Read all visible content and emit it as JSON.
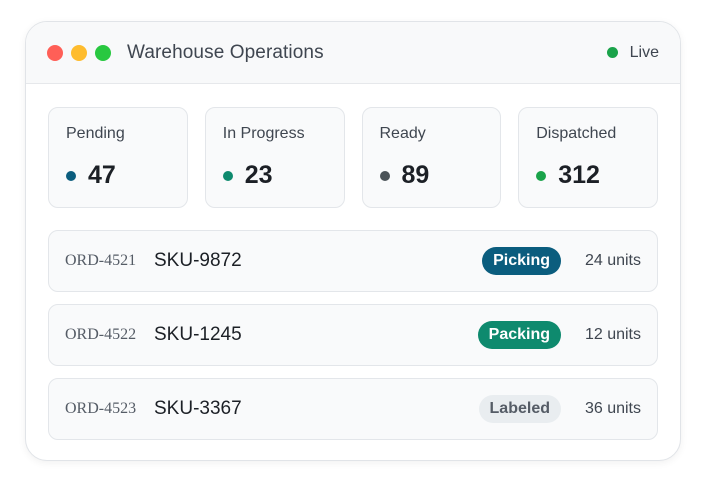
{
  "window": {
    "title": "Warehouse Operations",
    "traffic_lights": {
      "close_color": "#ff5f57",
      "minimize_color": "#febc2e",
      "maximize_color": "#28c840"
    },
    "status": {
      "label": "Live",
      "color": "#1aa34a"
    }
  },
  "stats": [
    {
      "label": "Pending",
      "value": "47",
      "color": "#0b5d7e"
    },
    {
      "label": "In Progress",
      "value": "23",
      "color": "#0e8a6e"
    },
    {
      "label": "Ready",
      "value": "89",
      "color": "#4b5358"
    },
    {
      "label": "Dispatched",
      "value": "312",
      "color": "#1aa34a"
    }
  ],
  "orders": [
    {
      "id": "ORD-4521",
      "sku": "SKU-9872",
      "status": "Picking",
      "status_bg": "#0b5d7e",
      "status_fg": "#ffffff",
      "units": "24 units"
    },
    {
      "id": "ORD-4522",
      "sku": "SKU-1245",
      "status": "Packing",
      "status_bg": "#0e8a6e",
      "status_fg": "#ffffff",
      "units": "12 units"
    },
    {
      "id": "ORD-4523",
      "sku": "SKU-3367",
      "status": "Labeled",
      "status_bg": "#e9edf0",
      "status_fg": "#555c66",
      "units": "36 units"
    }
  ]
}
